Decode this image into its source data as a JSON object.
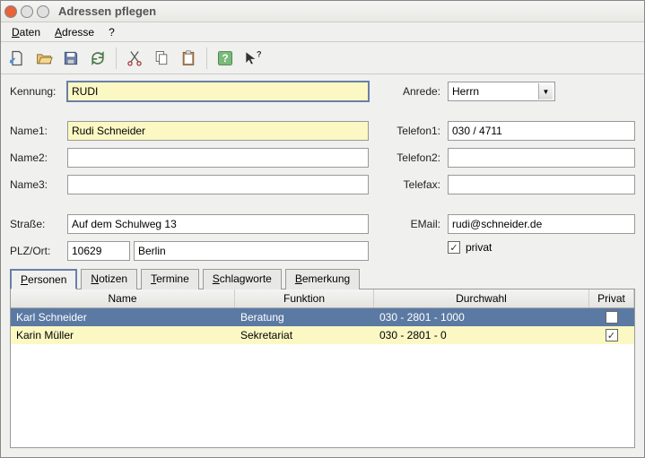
{
  "window": {
    "title": "Adressen pflegen"
  },
  "menu": {
    "daten": "Daten",
    "adresse": "Adresse",
    "help": "?"
  },
  "form": {
    "kennung_label": "Kennung:",
    "kennung": "RUDI",
    "name1_label": "Name1:",
    "name1": "Rudi Schneider",
    "name2_label": "Name2:",
    "name2": "",
    "name3_label": "Name3:",
    "name3": "",
    "strasse_label": "Straße:",
    "strasse": "Auf dem Schulweg 13",
    "plz_label": "PLZ/Ort:",
    "plz": "10629",
    "ort": "Berlin",
    "anrede_label": "Anrede:",
    "anrede": "Herrn",
    "tel1_label": "Telefon1:",
    "tel1": "030 / 4711",
    "tel2_label": "Telefon2:",
    "tel2": "",
    "fax_label": "Telefax:",
    "fax": "",
    "email_label": "EMail:",
    "email": "rudi@schneider.de",
    "privat_label": "privat",
    "privat_checked": true
  },
  "tabs": {
    "personen": "Personen",
    "notizen": "Notizen",
    "termine": "Termine",
    "schlagworte": "Schlagworte",
    "bemerkung": "Bemerkung"
  },
  "grid": {
    "head": {
      "name": "Name",
      "funktion": "Funktion",
      "durchwahl": "Durchwahl",
      "privat": "Privat"
    },
    "rows": [
      {
        "name": "Karl Schneider",
        "funktion": "Beratung",
        "durchwahl": "030 - 2801 - 1000",
        "privat": false
      },
      {
        "name": "Karin Müller",
        "funktion": "Sekretariat",
        "durchwahl": "030 - 2801 - 0",
        "privat": true
      }
    ]
  }
}
